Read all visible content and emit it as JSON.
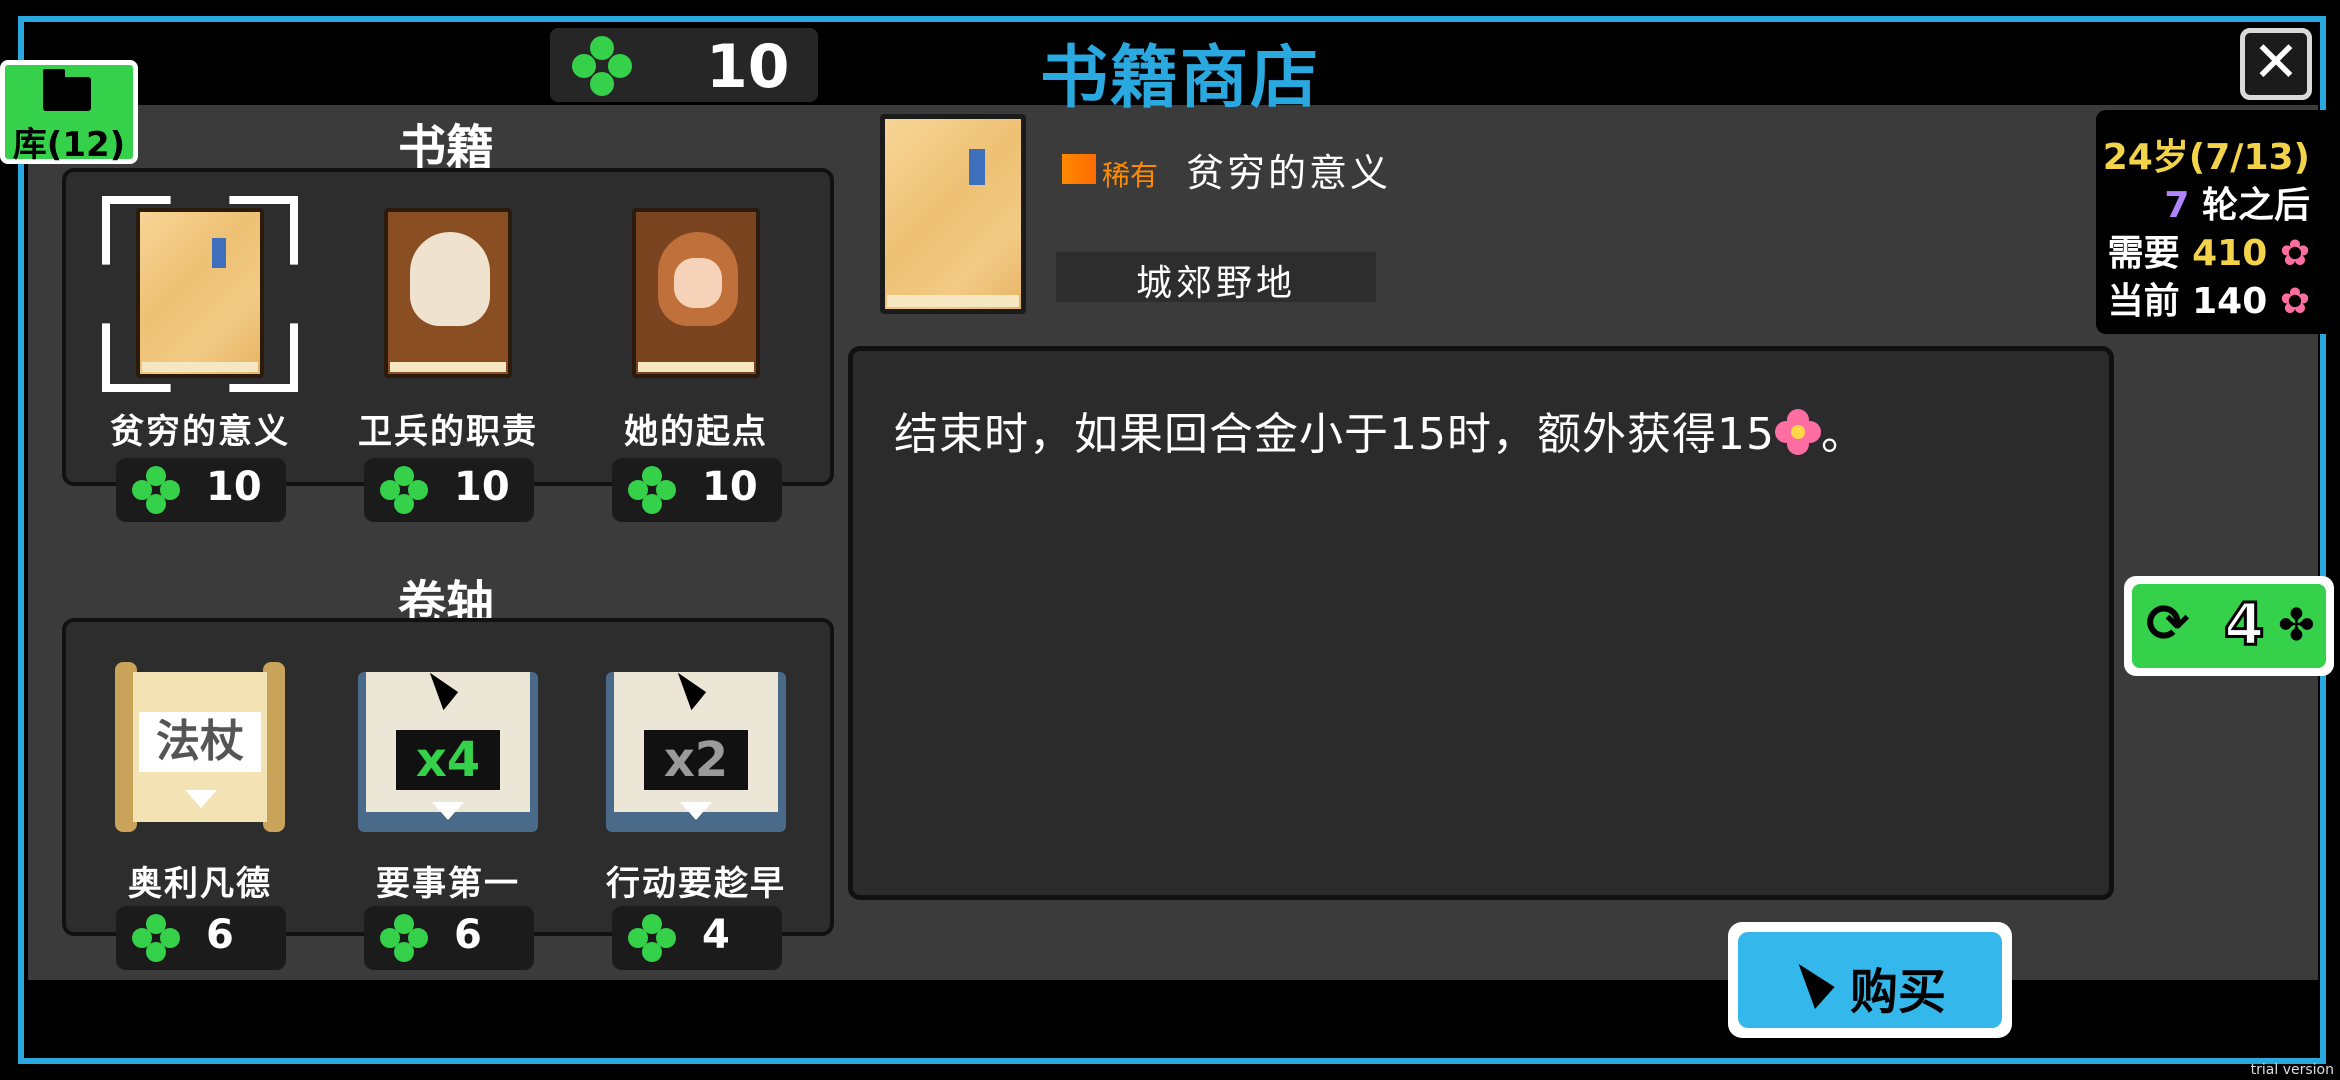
{
  "header": {
    "title": "书籍商店",
    "currency": "10",
    "close": "✕"
  },
  "library_tab": {
    "label": "库(12)"
  },
  "books": {
    "section_title": "书籍",
    "items": [
      {
        "label": "贫穷的意义",
        "price": "10"
      },
      {
        "label": "卫兵的职责",
        "price": "10"
      },
      {
        "label": "她的起点",
        "price": "10"
      }
    ]
  },
  "scrolls": {
    "section_title": "卷轴",
    "items": [
      {
        "label": "奥利凡德",
        "price": "6",
        "art_text": "法杖"
      },
      {
        "label": "要事第一",
        "price": "6",
        "art_text": "x4"
      },
      {
        "label": "行动要趁早",
        "price": "4",
        "art_text": "x2"
      }
    ]
  },
  "detail": {
    "rarity": "稀有",
    "name": "贫穷的意义",
    "location": "城郊野地",
    "description": "结束时，如果回合金小于15时，额外获得15",
    "description_end": "。"
  },
  "status": {
    "age_num": "24",
    "age_suffix": "岁(7/13)",
    "rounds_num": "7",
    "rounds_suffix": " 轮之后",
    "need_label": "需要",
    "need_value": "410",
    "current_label": "当前",
    "current_value": "140"
  },
  "refresh": {
    "count": "4"
  },
  "buy": {
    "label": "购买"
  },
  "watermark": "trial version",
  "colors": {
    "accent": "#2aa9e0",
    "clover": "#35d14b",
    "rare": "#ff8a00",
    "flower": "#ff6ea0"
  }
}
